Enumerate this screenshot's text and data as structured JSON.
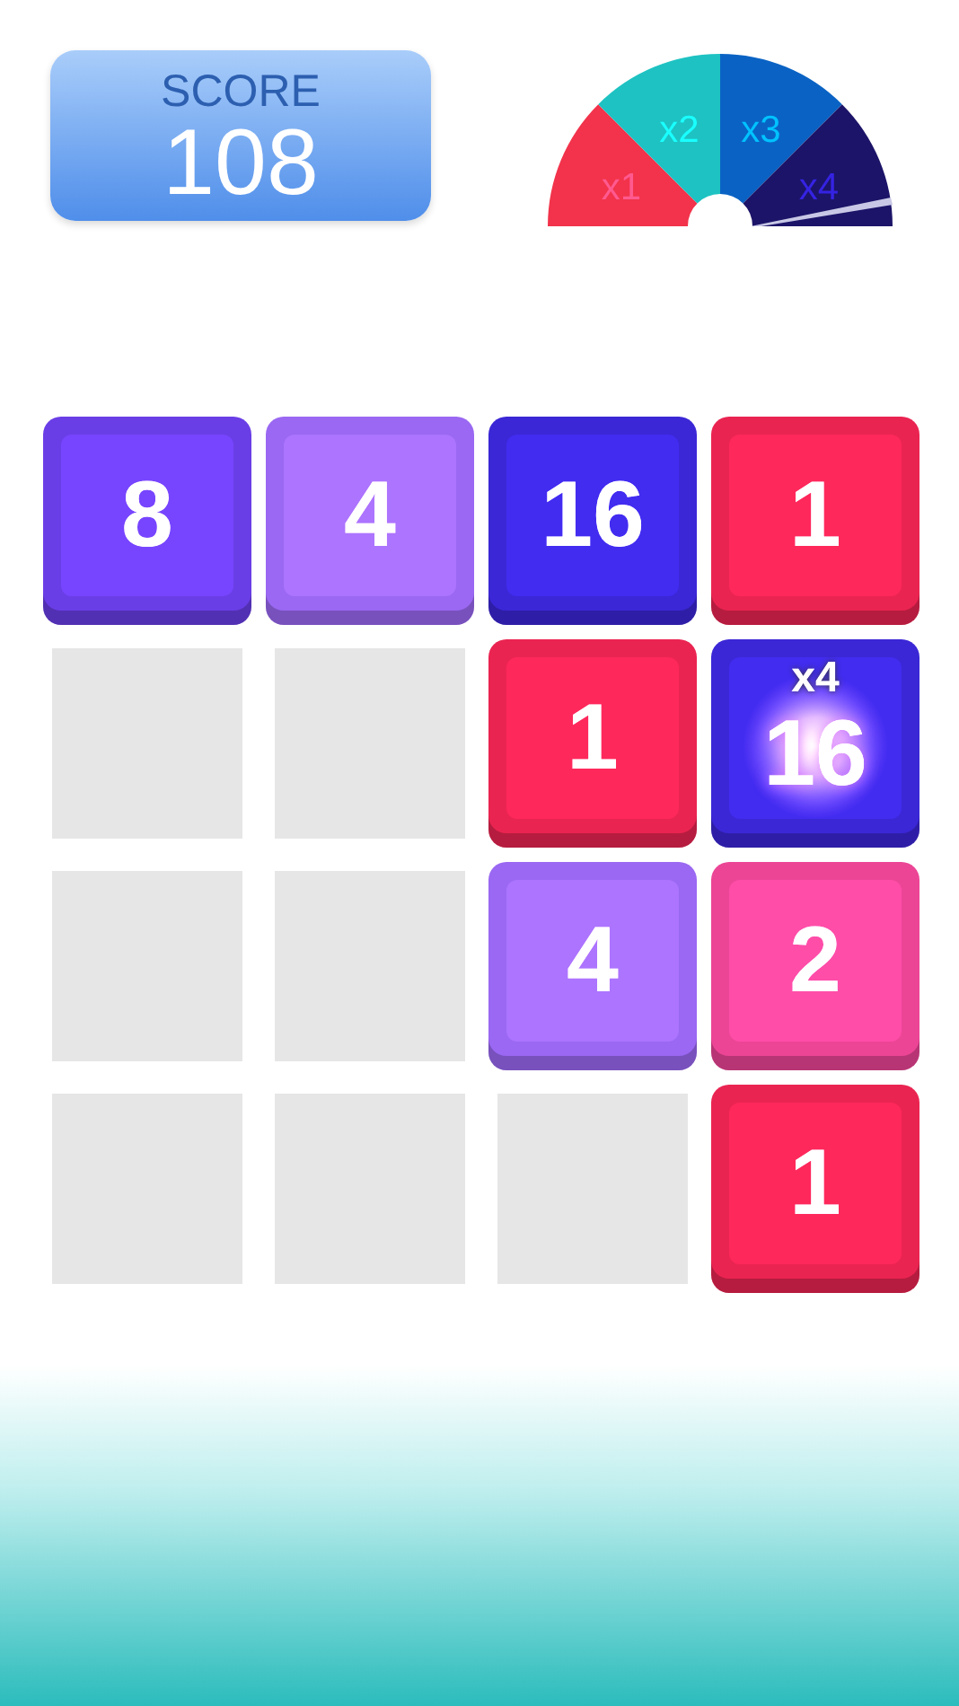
{
  "score": {
    "label": "SCORE",
    "value": "108"
  },
  "multiplier_gauge": [
    {
      "label": "x1",
      "color": "#f2334b"
    },
    {
      "label": "x2",
      "color": "#1ec2c2"
    },
    {
      "label": "x3",
      "color": "#0a63c4"
    },
    {
      "label": "x4",
      "color": "#1c1468"
    }
  ],
  "board": [
    {
      "kind": "tile",
      "value": "8",
      "color": "#6a3ee6"
    },
    {
      "kind": "tile",
      "value": "4",
      "color": "#9a68f2"
    },
    {
      "kind": "tile",
      "value": "16",
      "color": "#3b27d6"
    },
    {
      "kind": "tile",
      "value": "1",
      "color": "#ea2451"
    },
    {
      "kind": "empty"
    },
    {
      "kind": "empty"
    },
    {
      "kind": "tile",
      "value": "1",
      "color": "#ea2451"
    },
    {
      "kind": "tile",
      "value": "16",
      "color": "#3b27d6",
      "badge": "x4"
    },
    {
      "kind": "empty"
    },
    {
      "kind": "empty"
    },
    {
      "kind": "tile",
      "value": "4",
      "color": "#9a68f2"
    },
    {
      "kind": "tile",
      "value": "2",
      "color": "#ec4596"
    },
    {
      "kind": "empty"
    },
    {
      "kind": "empty"
    },
    {
      "kind": "empty"
    },
    {
      "kind": "tile",
      "value": "1",
      "color": "#ea2451"
    }
  ]
}
